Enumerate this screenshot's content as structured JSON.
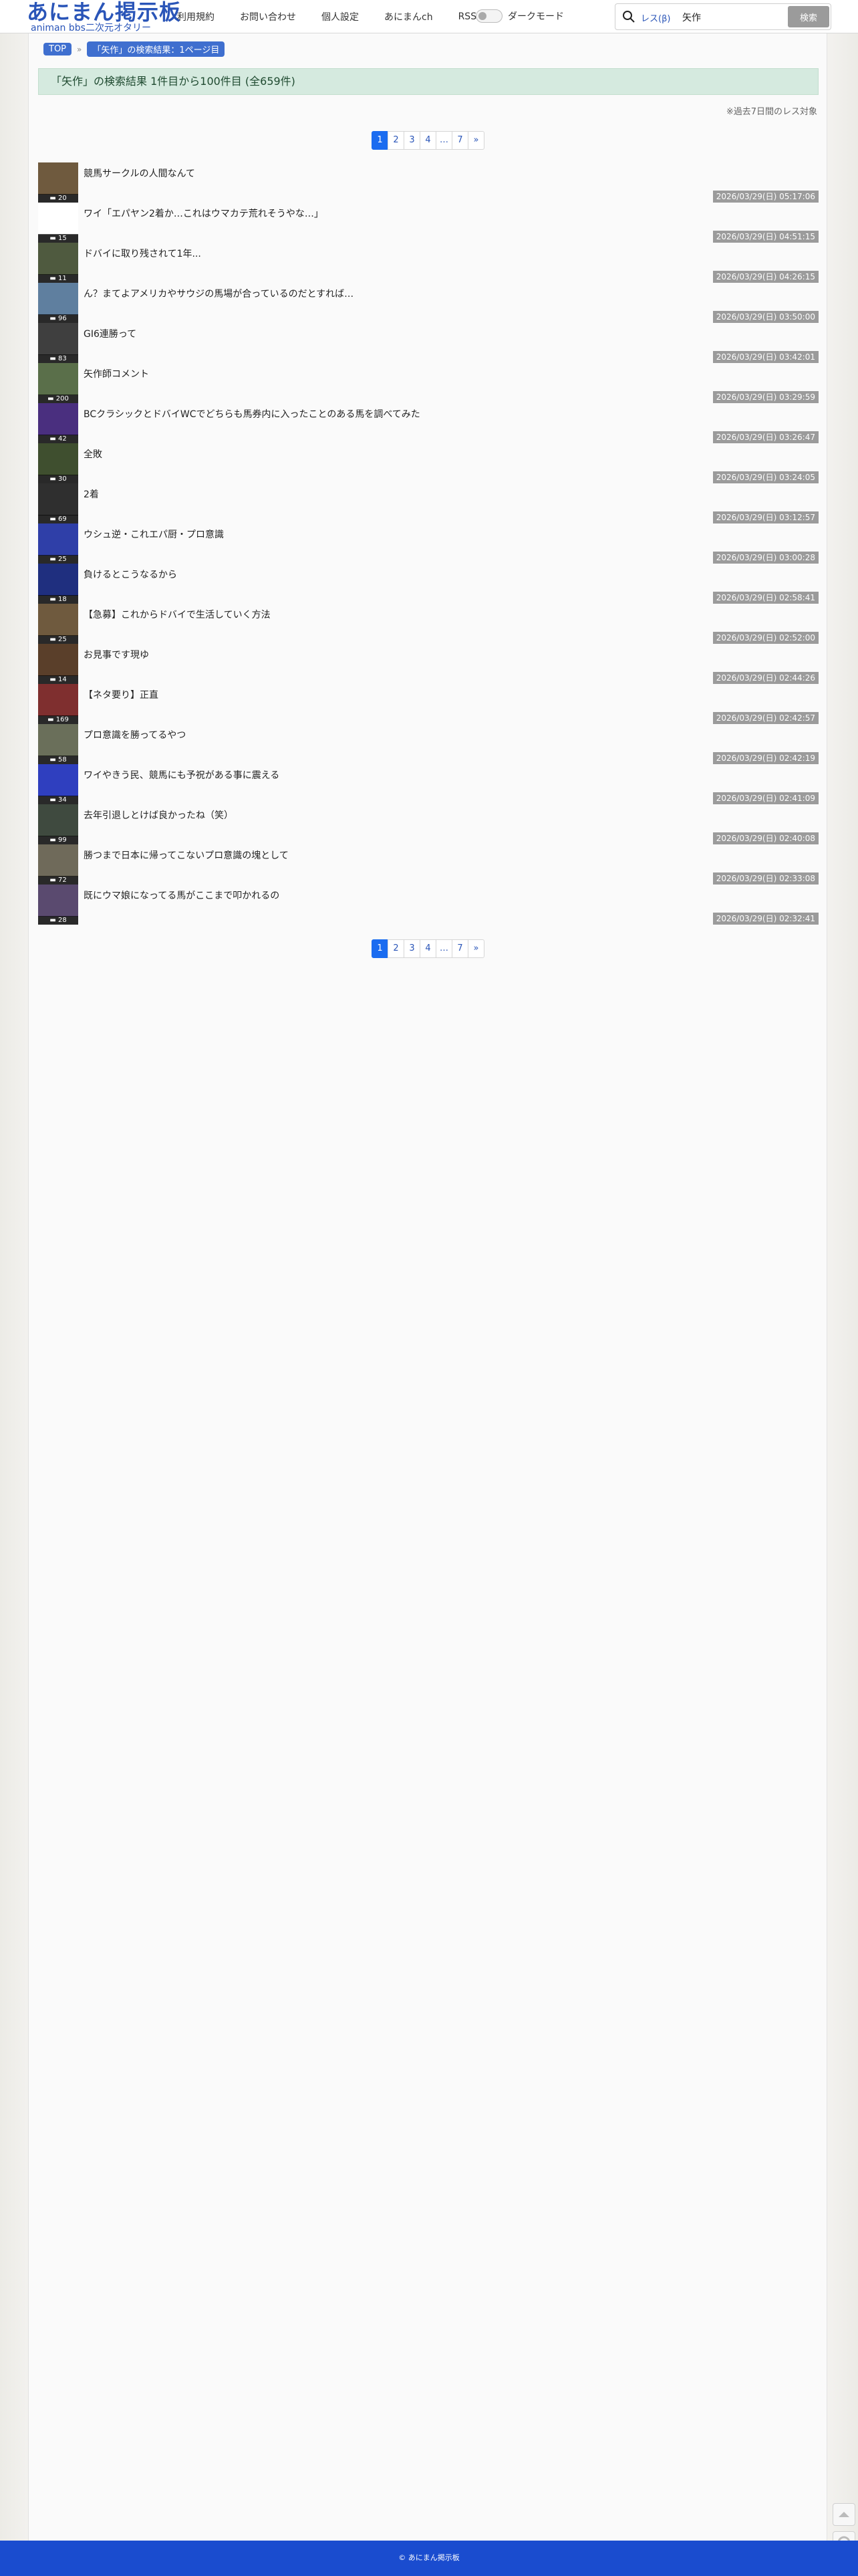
{
  "header": {
    "logo_title": "あにまん掲示板",
    "logo_subtitle": "animan bbs二次元オタリー",
    "nav": [
      "利用規約",
      "お問い合わせ",
      "個人設定",
      "あにまんch",
      "RSS"
    ],
    "dark_mode_label": "ダークモード",
    "search_scope": "レス(β)",
    "search_value": "矢作",
    "search_button": "検索"
  },
  "breadcrumb": {
    "top": "TOP",
    "current": "「矢作」の検索結果：1ページ目"
  },
  "result_text": "「矢作」の検索結果 1件目から100件目 (全659件)",
  "note": "※過去7日間のレス対象",
  "pagination": [
    "1",
    "2",
    "3",
    "4",
    "…",
    "7",
    "»"
  ],
  "items": [
    {
      "title": "競馬サークルの人間なんて",
      "count": "20",
      "date": "2026/03/29(日) 05:17:06",
      "color": "#6f5a3e"
    },
    {
      "title": "ワイ「エパヤン2着か…これはウマカテ荒れそうやな…」",
      "count": "15",
      "date": "2026/03/29(日) 04:51:15",
      "color": "#ffffff"
    },
    {
      "title": "ドバイに取り残されて1年...",
      "count": "11",
      "date": "2026/03/29(日) 04:26:15",
      "color": "#4f5a3f"
    },
    {
      "title": "ん？まてよアメリカやサウジの馬場が合っているのだとすれば…",
      "count": "96",
      "date": "2026/03/29(日) 03:50:00",
      "color": "#5f7f9f"
    },
    {
      "title": "GI6連勝って",
      "count": "83",
      "date": "2026/03/29(日) 03:42:01",
      "color": "#3f3f3f"
    },
    {
      "title": "矢作師コメント",
      "count": "200",
      "date": "2026/03/29(日) 03:29:59",
      "color": "#5a6f4a"
    },
    {
      "title": "BCクラシックとドバイWCでどちらも馬券内に入ったことのある馬を調べてみた",
      "count": "42",
      "date": "2026/03/29(日) 03:26:47",
      "color": "#4a2f7f"
    },
    {
      "title": "全敗",
      "count": "30",
      "date": "2026/03/29(日) 03:24:05",
      "color": "#3f4f2f"
    },
    {
      "title": "2着",
      "count": "69",
      "date": "2026/03/29(日) 03:12:57",
      "color": "#2f2f2f"
    },
    {
      "title": "ウシュ逆・これエパ厨・プロ意識",
      "count": "25",
      "date": "2026/03/29(日) 03:00:28",
      "color": "#2f3fa8"
    },
    {
      "title": "負けるとこうなるから",
      "count": "18",
      "date": "2026/03/29(日) 02:58:41",
      "color": "#1f2f7f"
    },
    {
      "title": "【急募】これからドバイで生活していく方法",
      "count": "25",
      "date": "2026/03/29(日) 02:52:00",
      "color": "#6f5a3e"
    },
    {
      "title": "お見事です現ゆ",
      "count": "14",
      "date": "2026/03/29(日) 02:44:26",
      "color": "#5a3f2a"
    },
    {
      "title": "【ネタ要り】正直",
      "count": "169",
      "date": "2026/03/29(日) 02:42:57",
      "color": "#7f2f2f"
    },
    {
      "title": "プロ意識を勝ってるやつ",
      "count": "58",
      "date": "2026/03/29(日) 02:42:19",
      "color": "#6a6f5a"
    },
    {
      "title": "ワイやきう民、競馬にも予祝がある事に震える",
      "count": "34",
      "date": "2026/03/29(日) 02:41:09",
      "color": "#2f3fbf"
    },
    {
      "title": "去年引退しとけば良かったね（笑）",
      "count": "99",
      "date": "2026/03/29(日) 02:40:08",
      "color": "#3f4a3f"
    },
    {
      "title": "勝つまで日本に帰ってこないプロ意識の塊として",
      "count": "72",
      "date": "2026/03/29(日) 02:33:08",
      "color": "#6f6a5a"
    },
    {
      "title": "既にウマ娘になってる馬がここまで叩かれるの",
      "count": "28",
      "date": "2026/03/29(日) 02:32:41",
      "color": "#5a4a6f"
    }
  ],
  "footer": "© あにまん掲示板"
}
